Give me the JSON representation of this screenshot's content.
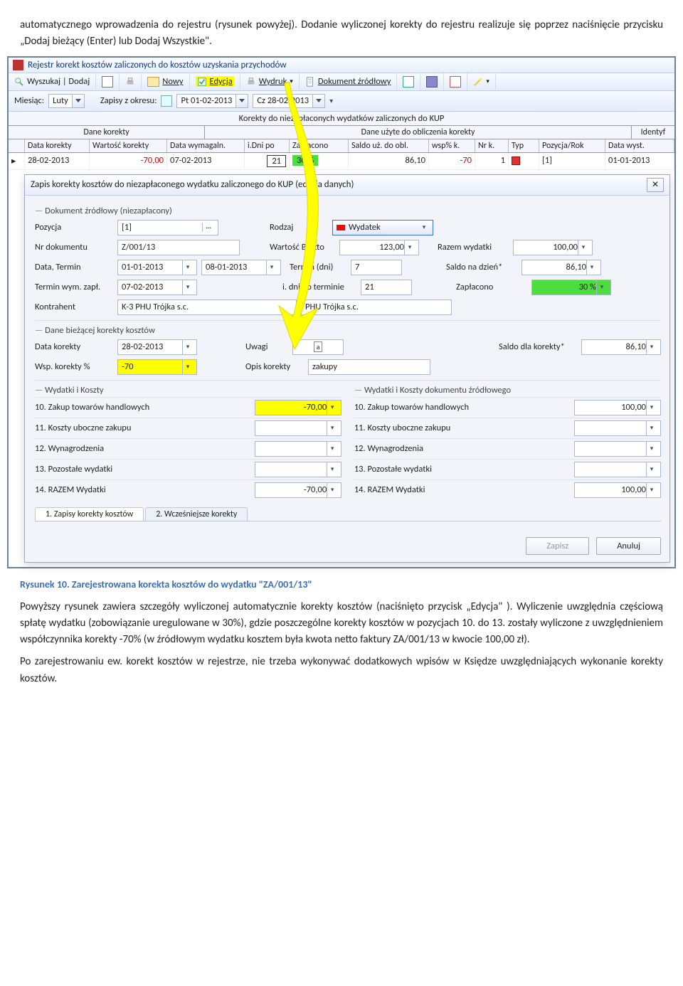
{
  "doc": {
    "intro": "automatycznego wprowadzenia do rejestru (rysunek powyżej). Dodanie wyliczonej korekty do rejestru realizuje się poprzez naciśnięcie przycisku „Dodaj bieżący (Enter) lub Dodaj Wszystkie\".",
    "caption_no": "Rysunek 10.",
    "caption_txt": "Zarejestrowana korekta kosztów do wydatku \"ZA/001/13\"",
    "para2": "Powyższy rysunek zawiera szczegóły wyliczonej automatycznie korekty kosztów (naciśnięto przycisk „Edycja\" ). Wyliczenie uwzględnia częściową spłatę wydatku (zobowiązanie uregulowane w 30%), gdzie poszczególne korekty kosztów w pozycjach 10. do 13. zostały wyliczone z uwzględnieniem współczynnika korekty -70% (w źródłowym wydatku kosztem była kwota netto faktury ZA/001/13 w kwocie 100,00 zł).",
    "para3": "Po zarejestrowaniu ew. korekt kosztów w rejestrze, nie trzeba wykonywać dodatkowych wpisów w Księdze uwzględniających wykonanie korekty kosztów."
  },
  "app": {
    "title": "Rejestr korekt kosztów zaliczonych do kosztów uzyskania przychodów",
    "toolbar": {
      "wyszukaj": "Wyszukaj | Dodaj",
      "nowy": "Nowy",
      "edycja": "Edycja",
      "wydruk": "Wydruk",
      "dokument": "Dokument źródłowy"
    },
    "filters": {
      "miesiac_lbl": "Miesiąc:",
      "miesiac_val": "Luty",
      "zapisy_lbl": "Zapisy z okresu:",
      "date_from": "Pt 01-02-2013",
      "date_to": "Cz 28-02-2013"
    },
    "grid": {
      "top_header": "Korekty do niezapłaconych wydatków zaliczonych do KUP",
      "groups": [
        "Dane korekty",
        "Dane użyte do obliczenia korekty",
        "Identyf"
      ],
      "cols": [
        "Data korekty",
        "Wartość korekty",
        "Data wymagaln.",
        "i.Dni po",
        "Zapłacono",
        "Saldo uż. do obl.",
        "wsp% k.",
        "Nr k.",
        "Typ",
        "Pozycja/Rok",
        "Data wyst."
      ],
      "row": {
        "data_korekty": "28-02-2013",
        "wartosc_korekty": "-70,00",
        "data_wymag": "07-02-2013",
        "dni": "21",
        "zaplacono": "30 %",
        "saldo": "86,10",
        "wsp": "-70",
        "nrk": "1",
        "pozrok": "[1]",
        "data_wyst": "01-01-2013"
      }
    },
    "dialog": {
      "title": "Zapis korekty kosztów do niezapłaconego wydatku zaliczonego do KUP  (edycja danych)",
      "sec_dok": "Dokument źródłowy  (niezapłacony)",
      "pozycja_lbl": "Pozycja",
      "pozycja": "[1]",
      "rodzaj_lbl": "Rodzaj",
      "rodzaj": "Wydatek",
      "nrdok_lbl": "Nr dokumentu",
      "nrdok": "Z/001/13",
      "wb_lbl": "Wartość Brutto",
      "wb": "123,00",
      "razemw_lbl": "Razem wydatki",
      "razemw": "100,00",
      "data_lbl": "Data, Termin",
      "data1": "01-01-2013",
      "data2": "08-01-2013",
      "termin_lbl": "Termin (dni)",
      "termin": "7",
      "saldo_lbl": "Saldo na dzień*",
      "saldo": "86,10",
      "twz_lbl": "Termin wym. zapł.",
      "twz": "07-02-2013",
      "idp_lbl": "i. dni po terminie",
      "idp": "21",
      "zapl_lbl": "Zapłacono",
      "zapl": "30 %",
      "kontr_lbl": "Kontrahent",
      "kontr1": "K-3  PHU Trójka s.c.",
      "kontr2": "PHU Trójka s.c.",
      "sec_dane": "Dane bieżącej korekty kosztów",
      "dk_lbl": "Data korekty",
      "dk": "28-02-2013",
      "uwagi_lbl": "Uwagi",
      "uwagi": "a",
      "sdk_lbl": "Saldo dla korekty*",
      "sdk": "86,10",
      "wsp_lbl": "Wsp. korekty %",
      "wsp": "-70",
      "opis_lbl": "Opis korekty",
      "opis": "zakupy",
      "sec_wk": "Wydatki i Koszty",
      "sec_wkd": "Wydatki i Koszty dokumentu źródłowego",
      "rows": [
        "10. Zakup towarów handlowych",
        "11. Koszty uboczne zakupu",
        "12. Wynagrodzenia",
        "13. Pozostałe wydatki",
        "14. RAZEM Wydatki"
      ],
      "left_vals": [
        "-70,00",
        "",
        "",
        "",
        "-70,00"
      ],
      "right_vals": [
        "100,00",
        "",
        "",
        "",
        "100,00"
      ],
      "tab1": "1. Zapisy korekty kosztów",
      "tab2": "2. Wcześniejsze korekty",
      "btn_save": "Zapisz",
      "btn_cancel": "Anuluj"
    }
  }
}
